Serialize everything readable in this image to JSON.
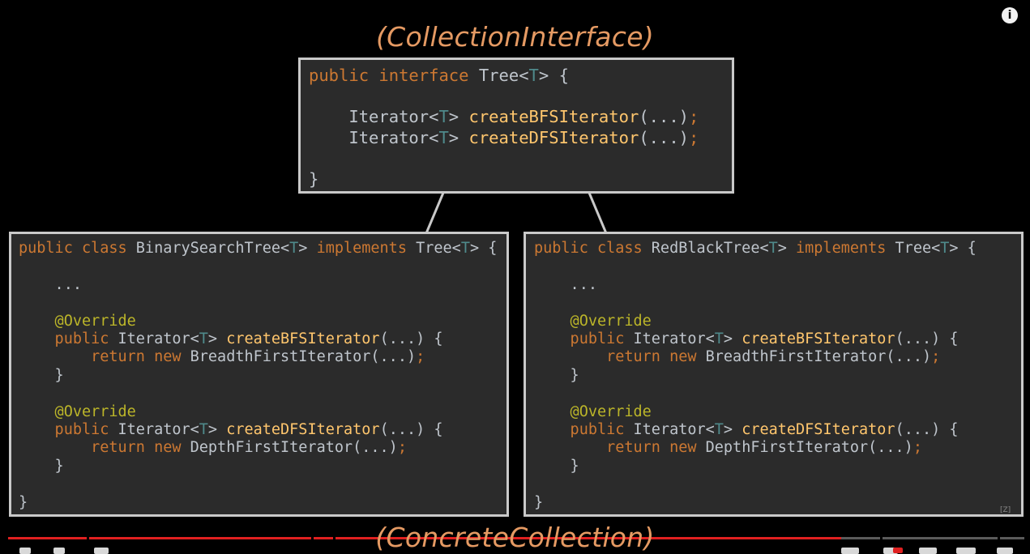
{
  "headings": {
    "top": "(CollectionInterface)",
    "bottom": "(ConcreteCollection)"
  },
  "interface_box": {
    "lines": [
      [
        [
          "kw",
          "public "
        ],
        [
          "kw",
          "interface "
        ],
        [
          "txt",
          "Tree"
        ],
        [
          "txt",
          "<"
        ],
        [
          "tp",
          "T"
        ],
        [
          "txt",
          "> {"
        ]
      ],
      [],
      [
        [
          "txt",
          "    Iterator<"
        ],
        [
          "tp",
          "T"
        ],
        [
          "txt",
          "> "
        ],
        [
          "mth",
          "createBFSIterator"
        ],
        [
          "txt",
          "(...)"
        ],
        [
          "semi",
          ";"
        ]
      ],
      [
        [
          "txt",
          "    Iterator<"
        ],
        [
          "tp",
          "T"
        ],
        [
          "txt",
          "> "
        ],
        [
          "mth",
          "createDFSIterator"
        ],
        [
          "txt",
          "(...)"
        ],
        [
          "semi",
          ";"
        ]
      ],
      [],
      [
        [
          "txt",
          "}"
        ]
      ]
    ]
  },
  "bst_box": {
    "lines": [
      [
        [
          "kw",
          "public "
        ],
        [
          "kw",
          "class "
        ],
        [
          "txt",
          "BinarySearchTree<"
        ],
        [
          "tp",
          "T"
        ],
        [
          "txt",
          "> "
        ],
        [
          "kw",
          "implements "
        ],
        [
          "txt",
          "Tree<"
        ],
        [
          "tp",
          "T"
        ],
        [
          "txt",
          "> {"
        ]
      ],
      [],
      [
        [
          "txt",
          "    ..."
        ]
      ],
      [],
      [
        [
          "ann",
          "    @Override"
        ]
      ],
      [
        [
          "kw",
          "    public "
        ],
        [
          "txt",
          "Iterator<"
        ],
        [
          "tp",
          "T"
        ],
        [
          "txt",
          "> "
        ],
        [
          "mth",
          "createBFSIterator"
        ],
        [
          "txt",
          "(...) {"
        ]
      ],
      [
        [
          "kw",
          "        return "
        ],
        [
          "kw",
          "new "
        ],
        [
          "txt",
          "BreadthFirstIterator(...)"
        ],
        [
          "semi",
          ";"
        ]
      ],
      [
        [
          "txt",
          "    }"
        ]
      ],
      [],
      [
        [
          "ann",
          "    @Override"
        ]
      ],
      [
        [
          "kw",
          "    public "
        ],
        [
          "txt",
          "Iterator<"
        ],
        [
          "tp",
          "T"
        ],
        [
          "txt",
          "> "
        ],
        [
          "mth",
          "createDFSIterator"
        ],
        [
          "txt",
          "(...) {"
        ]
      ],
      [
        [
          "kw",
          "        return "
        ],
        [
          "kw",
          "new "
        ],
        [
          "txt",
          "DepthFirstIterator(...)"
        ],
        [
          "semi",
          ";"
        ]
      ],
      [
        [
          "txt",
          "    }"
        ]
      ],
      [],
      [
        [
          "txt",
          "}"
        ]
      ]
    ]
  },
  "rbt_box": {
    "lines": [
      [
        [
          "kw",
          "public "
        ],
        [
          "kw",
          "class "
        ],
        [
          "txt",
          "RedBlackTree<"
        ],
        [
          "tp",
          "T"
        ],
        [
          "txt",
          "> "
        ],
        [
          "kw",
          "implements "
        ],
        [
          "txt",
          "Tree<"
        ],
        [
          "tp",
          "T"
        ],
        [
          "txt",
          "> {"
        ]
      ],
      [],
      [
        [
          "txt",
          "    ..."
        ]
      ],
      [],
      [
        [
          "ann",
          "    @Override"
        ]
      ],
      [
        [
          "kw",
          "    public "
        ],
        [
          "txt",
          "Iterator<"
        ],
        [
          "tp",
          "T"
        ],
        [
          "txt",
          "> "
        ],
        [
          "mth",
          "createBFSIterator"
        ],
        [
          "txt",
          "(...) {"
        ]
      ],
      [
        [
          "kw",
          "        return "
        ],
        [
          "kw",
          "new "
        ],
        [
          "txt",
          "BreadthFirstIterator(...)"
        ],
        [
          "semi",
          ";"
        ]
      ],
      [
        [
          "txt",
          "    }"
        ]
      ],
      [],
      [
        [
          "ann",
          "    @Override"
        ]
      ],
      [
        [
          "kw",
          "    public "
        ],
        [
          "txt",
          "Iterator<"
        ],
        [
          "tp",
          "T"
        ],
        [
          "txt",
          "> "
        ],
        [
          "mth",
          "createDFSIterator"
        ],
        [
          "txt",
          "(...) {"
        ]
      ],
      [
        [
          "kw",
          "        return "
        ],
        [
          "kw",
          "new "
        ],
        [
          "txt",
          "DepthFirstIterator(...)"
        ],
        [
          "semi",
          ";"
        ]
      ],
      [
        [
          "txt",
          "    }"
        ]
      ],
      [],
      [
        [
          "txt",
          "}"
        ]
      ]
    ]
  },
  "player": {
    "info_icon": "info-icon",
    "progress_fraction": 0.82
  },
  "colors": {
    "heading": "#e59a63",
    "keyword": "#cc7832",
    "type_param": "#4f8a8b",
    "method": "#ffc66d",
    "annotation": "#bbb529",
    "text": "#bfc5cc",
    "box_bg": "#2b2b2b",
    "box_border": "#c9c9c9",
    "progress": "#e02020"
  }
}
